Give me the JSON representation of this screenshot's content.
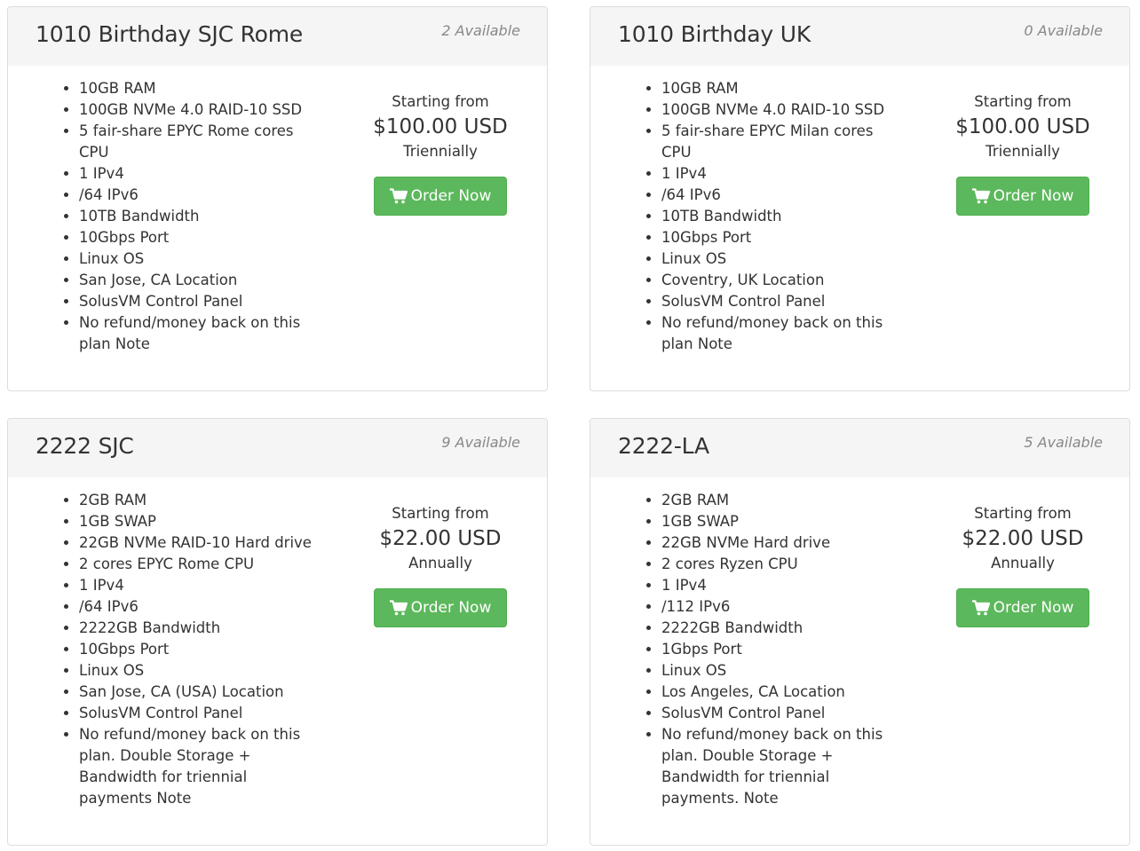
{
  "colors": {
    "button_bg": "#5cb85c",
    "header_bg": "#f5f5f5",
    "border": "#dddddd",
    "availability_text": "#888888"
  },
  "products": [
    {
      "title": "1010 Birthday SJC Rome",
      "availability": "2 Available",
      "features": [
        "10GB RAM",
        "100GB NVMe 4.0 RAID-10 SSD",
        "5 fair-share EPYC Rome cores CPU",
        "1 IPv4",
        "/64 IPv6",
        "10TB Bandwidth",
        "10Gbps Port",
        "Linux OS",
        "San Jose, CA Location",
        "SolusVM Control Panel",
        "No refund/money back on this plan Note"
      ],
      "starting_label": "Starting from",
      "price": "$100.00 USD",
      "cycle": "Triennially",
      "order_label": "Order Now",
      "order_icon": "shopping-cart-icon"
    },
    {
      "title": "1010 Birthday UK",
      "availability": "0 Available",
      "features": [
        "10GB RAM",
        "100GB NVMe 4.0 RAID-10 SSD",
        "5 fair-share EPYC Milan cores CPU",
        "1 IPv4",
        "/64 IPv6",
        "10TB Bandwidth",
        "10Gbps Port",
        "Linux OS",
        "Coventry, UK Location",
        "SolusVM Control Panel",
        "No refund/money back on this plan Note"
      ],
      "starting_label": "Starting from",
      "price": "$100.00 USD",
      "cycle": "Triennially",
      "order_label": "Order Now",
      "order_icon": "shopping-cart-icon"
    },
    {
      "title": "2222 SJC",
      "availability": "9 Available",
      "features": [
        "2GB RAM",
        "1GB SWAP",
        "22GB NVMe RAID-10 Hard drive",
        "2 cores EPYC Rome CPU",
        "1 IPv4",
        "/64 IPv6",
        "2222GB Bandwidth",
        "10Gbps Port",
        "Linux OS",
        "San Jose, CA (USA) Location",
        "SolusVM Control Panel",
        "No refund/money back on this plan. Double Storage + Bandwidth for triennial payments Note"
      ],
      "starting_label": "Starting from",
      "price": "$22.00 USD",
      "cycle": "Annually",
      "order_label": "Order Now",
      "order_icon": "shopping-cart-icon"
    },
    {
      "title": "2222-LA",
      "availability": "5 Available",
      "features": [
        "2GB RAM",
        "1GB SWAP",
        "22GB NVMe Hard drive",
        "2 cores Ryzen CPU",
        "1 IPv4",
        "/112 IPv6",
        "2222GB Bandwidth",
        "1Gbps Port",
        "Linux OS",
        "Los Angeles, CA Location",
        "SolusVM Control Panel",
        "No refund/money back on this plan. Double Storage + Bandwidth for triennial payments. Note"
      ],
      "starting_label": "Starting from",
      "price": "$22.00 USD",
      "cycle": "Annually",
      "order_label": "Order Now",
      "order_icon": "shopping-cart-icon"
    }
  ]
}
